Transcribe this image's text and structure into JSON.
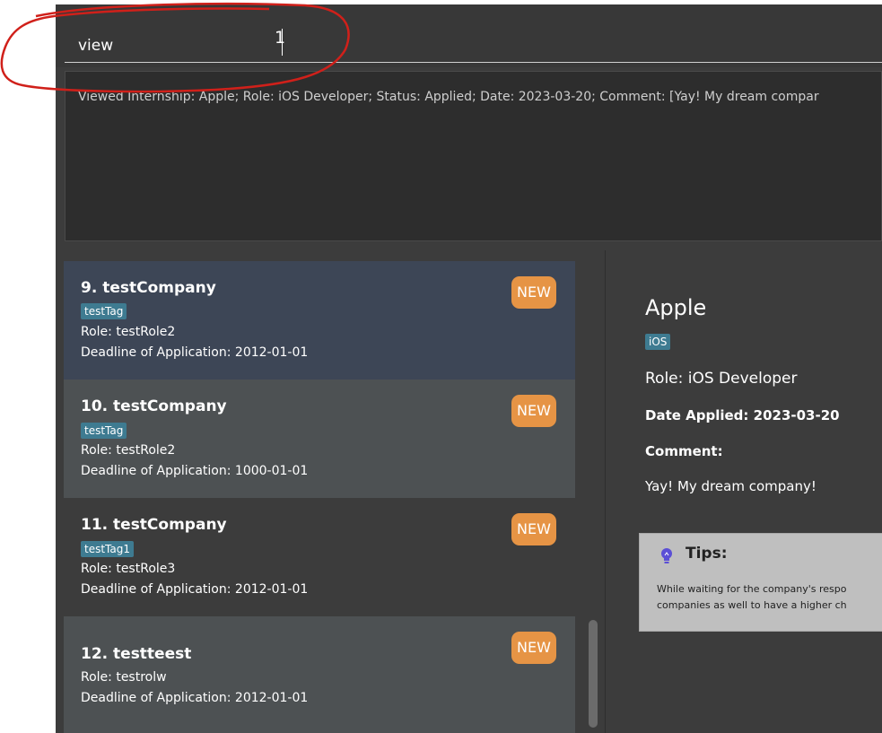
{
  "command": {
    "value": "view",
    "typed_suffix": "1"
  },
  "result": {
    "text": "Viewed Internship: Apple; Role: iOS Developer; Status: Applied; Date: 2023-03-20; Comment: [Yay! My dream compar"
  },
  "list": {
    "items": [
      {
        "index_title": "9.  testCompany",
        "tag": "testTag",
        "role": "Role: testRole2",
        "deadline": "Deadline of Application: 2012-01-01",
        "badge": "NEW"
      },
      {
        "index_title": "10.  testCompany",
        "tag": "testTag",
        "role": "Role: testRole2",
        "deadline": "Deadline of Application: 1000-01-01",
        "badge": "NEW"
      },
      {
        "index_title": "11.  testCompany",
        "tag": "testTag1",
        "role": "Role: testRole3",
        "deadline": "Deadline of Application: 2012-01-01",
        "badge": "NEW"
      },
      {
        "index_title": "12.  testteest",
        "tag": "",
        "role": "Role: testrolw",
        "deadline": "Deadline of Application: 2012-01-01",
        "badge": "NEW"
      }
    ]
  },
  "detail": {
    "company": "Apple",
    "tag": "iOS",
    "role": "Role: iOS Developer",
    "date": "Date Applied: 2023-03-20",
    "comment_label": "Comment:",
    "comment": "Yay! My dream company!",
    "tips": {
      "title": "Tips:",
      "line1": "While waiting for the company's respo",
      "line2": "companies as well to have a higher ch"
    }
  },
  "colors": {
    "app_bg": "#3c3c3c",
    "selected_card": "#3d4656",
    "light_card": "#4d5153",
    "tag": "#3e7b91",
    "badge": "#e69445",
    "annotation": "#d0201a",
    "tips_bg": "#bfbfbf"
  },
  "icons": {
    "tips": "lightbulb-icon"
  }
}
